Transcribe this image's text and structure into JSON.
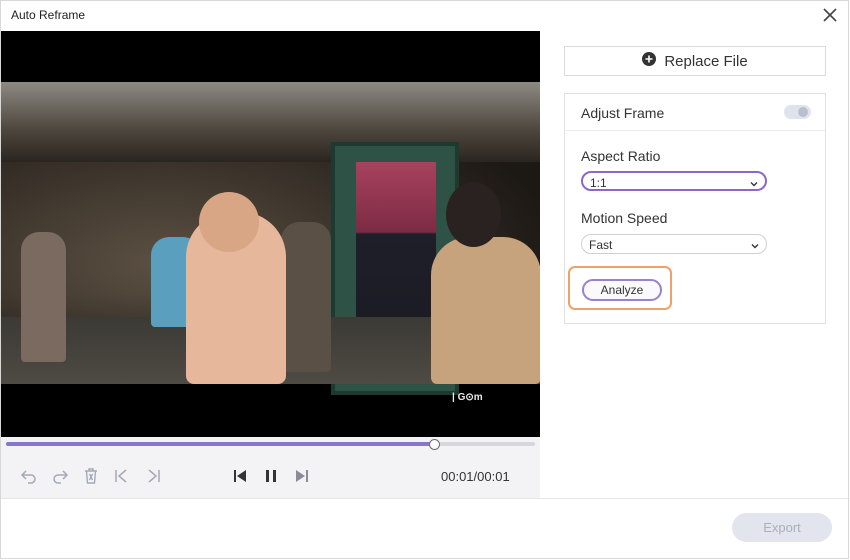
{
  "window": {
    "title": "Auto Reframe"
  },
  "player": {
    "progress_fraction": 0.81,
    "time": "00:01/00:01",
    "watermark": "| G⊙m"
  },
  "toolbar": {
    "icons": [
      "undo-icon",
      "redo-icon",
      "delete-icon",
      "mark-in-icon",
      "mark-out-icon",
      "skip-back-icon",
      "pause-icon",
      "skip-forward-icon"
    ]
  },
  "sidebar": {
    "replace_file_label": "Replace File",
    "adjust_frame_label": "Adjust Frame",
    "aspect_ratio_label": "Aspect Ratio",
    "aspect_ratio_value": "1:1",
    "motion_speed_label": "Motion Speed",
    "motion_speed_value": "Fast",
    "analyze_label": "Analyze"
  },
  "footer": {
    "export_label": "Export"
  },
  "colors": {
    "accent": "#8a67c8",
    "highlight": "#f0a16b",
    "progress_fill": "#8a76c9",
    "disabled_button": "#e2e5ee"
  }
}
